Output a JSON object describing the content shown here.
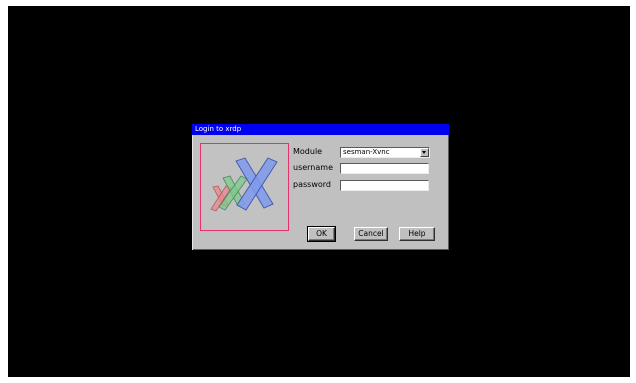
{
  "dialog": {
    "title": "Login to xrdp"
  },
  "logo": {
    "icon": "xrdp-x-logo-icon",
    "colors": {
      "frame": "#e8306a",
      "blue": "#7f9aec",
      "green": "#7ec98e",
      "red": "#e58a8e"
    }
  },
  "form": {
    "module_label": "Module",
    "module_value": "sesman-Xvnc",
    "username_label": "username",
    "username_value": "",
    "password_label": "password",
    "password_value": ""
  },
  "buttons": {
    "ok": "OK",
    "cancel": "Cancel",
    "help": "Help"
  },
  "colors": {
    "desktop": "#000000",
    "titlebar": "#0000f0",
    "dialog_face": "#c0c0c0"
  }
}
